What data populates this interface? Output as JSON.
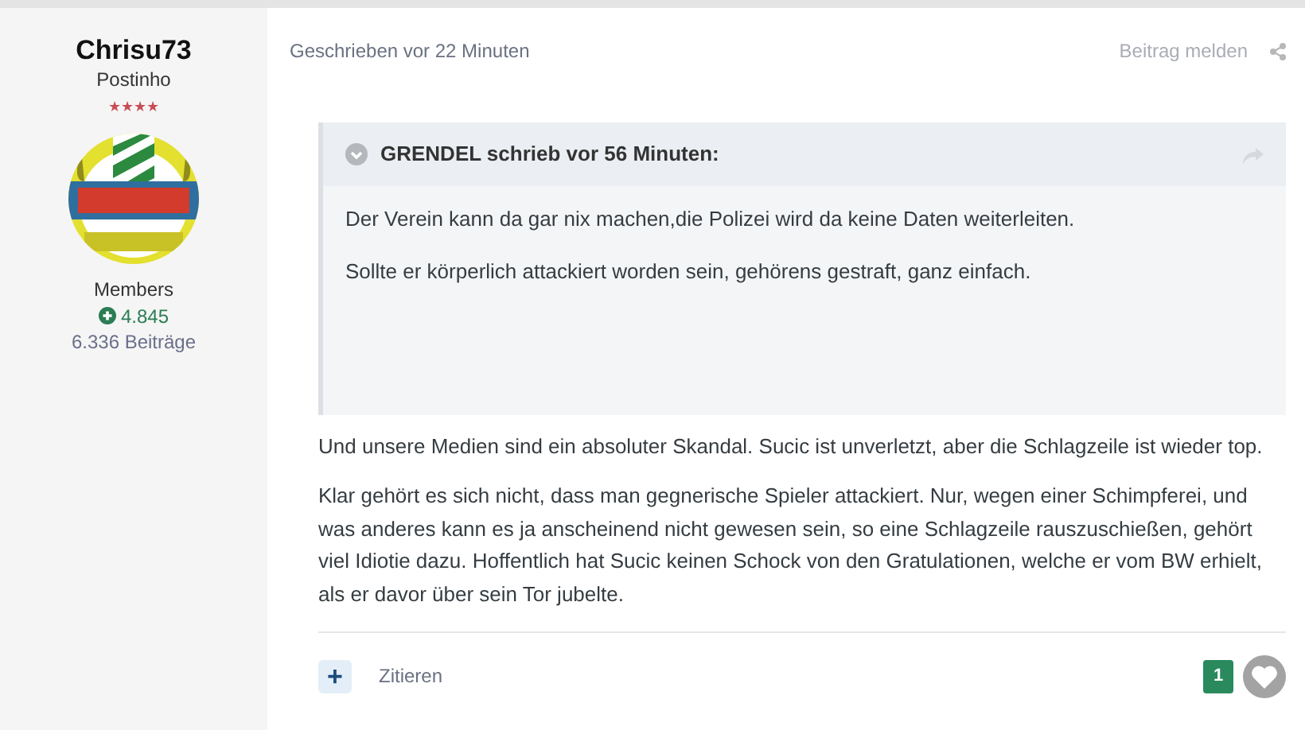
{
  "author": {
    "name": "Chrisu73",
    "rank_title": "Postinho",
    "rank_stars": "★★★★",
    "group": "Members",
    "reputation": "4.845",
    "post_count": "6.336 Beiträge"
  },
  "post": {
    "timestamp": "Geschrieben vor 22 Minuten",
    "report_link": "Beitrag melden",
    "quote": {
      "header": "GRENDEL schrieb vor 56 Minuten:",
      "expanded": false,
      "paragraphs": [
        "Der Verein kann da gar nix machen,die Polizei wird da keine Daten weiterleiten.",
        "Sollte er körperlich attackiert worden sein, gehörens gestraft, ganz einfach."
      ]
    },
    "paragraphs": [
      "Und unsere Medien sind ein absoluter Skandal. Sucic ist unverletzt, aber die Schlagzeile ist wieder top.",
      "Klar gehört es sich nicht, dass man gegnerische Spieler attackiert. Nur, wegen einer Schimpferei, und was anderes kann es ja anscheinend nicht gewesen sein, so eine Schlagzeile  rauszuschießen,  gehört viel Idiotie dazu. Hoffentlich hat Sucic keinen Schock von den Gratulationen, welche er vom BW erhielt, als er davor über sein Tor jubelte."
    ],
    "multiquote_button": "+",
    "quote_button": "Zitieren",
    "reaction_count": "1",
    "liked": false
  }
}
